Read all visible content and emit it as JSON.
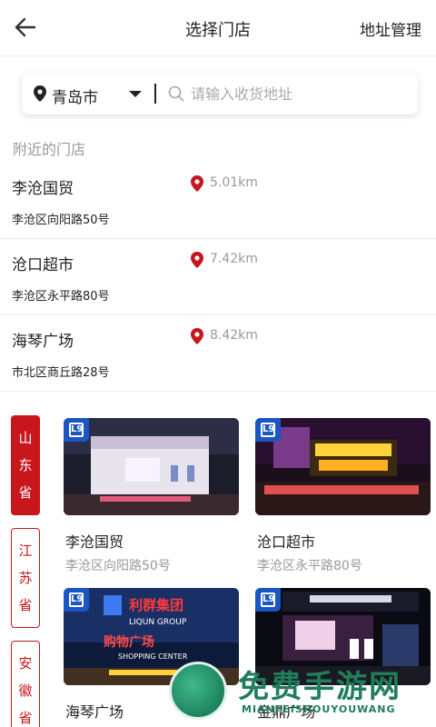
{
  "header": {
    "title": "选择门店",
    "right_action": "地址管理"
  },
  "search": {
    "city": "青岛市",
    "placeholder": "请输入收货地址",
    "value": ""
  },
  "nearby": {
    "section_title": "附近的门店",
    "stores": [
      {
        "name": "李沧国贸",
        "distance": "5.01km",
        "address": "李沧区向阳路50号"
      },
      {
        "name": "沧口超市",
        "distance": "7.42km",
        "address": "李沧区永平路80号"
      },
      {
        "name": "海琴广场",
        "distance": "8.42km",
        "address": "市北区商丘路28号"
      }
    ]
  },
  "provinces": [
    {
      "name": "山东省",
      "chars": [
        "山",
        "东",
        "省"
      ],
      "active": true
    },
    {
      "name": "江苏省",
      "chars": [
        "江",
        "苏",
        "省"
      ],
      "active": false
    },
    {
      "name": "安徽省",
      "chars": [
        "安",
        "徽",
        "省"
      ],
      "active": false
    }
  ],
  "store_cards": [
    {
      "name": "李沧国贸",
      "address": "李沧区向阳路50号"
    },
    {
      "name": "沧口超市",
      "address": "李沧区永平路80号"
    },
    {
      "name": "海琴广场",
      "address": ""
    },
    {
      "name": "金鼎广场",
      "address": ""
    }
  ],
  "card_image_text": {
    "sign1": "利群集团",
    "sign1_en": "LIQUN GROUP",
    "sign2": "购物广场",
    "sign2_en": "SHOPPING CENTER",
    "sign3": "沧口超市"
  },
  "watermark": {
    "title": "免费手游网",
    "sub": "MIANFEISHOUYOUWANG"
  },
  "colors": {
    "accent": "#c8161d",
    "badge": "#1a56c4",
    "muted": "#999999"
  }
}
